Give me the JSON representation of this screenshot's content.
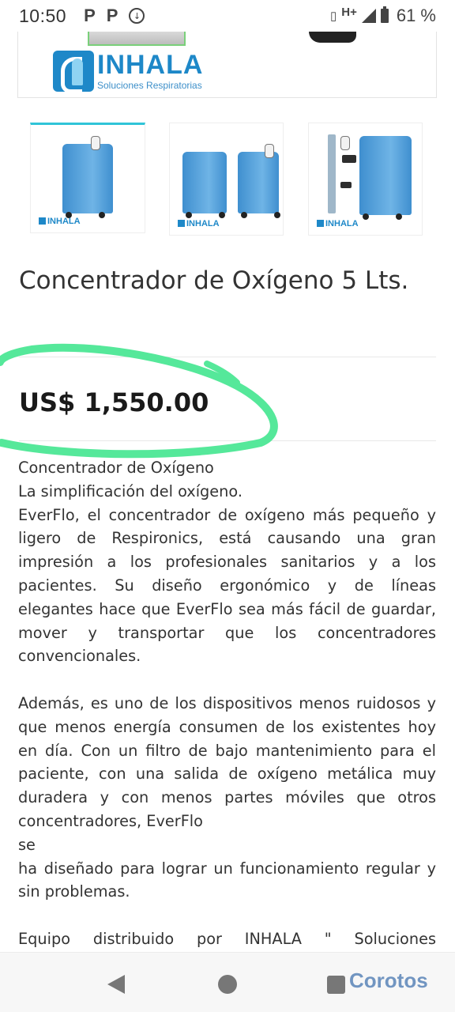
{
  "status_bar": {
    "time": "10:50",
    "left_icons": [
      "P",
      "P"
    ],
    "network": "H+",
    "battery": "61 %"
  },
  "logo": {
    "title": "INHALA",
    "subtitle": "Soluciones Respiratorias"
  },
  "thumbnails": [
    {
      "logo": "INHALA"
    },
    {
      "logo": "INHALA"
    },
    {
      "logo": "INHALA"
    }
  ],
  "product": {
    "title": "Concentrador de Oxígeno 5 Lts.",
    "price": "US$ 1,550.00",
    "description": {
      "line1": "Concentrador de Oxígeno",
      "line2": "La simplificación del oxígeno.",
      "para1": "EverFlo, el concentrador de oxígeno más pequeño y ligero de Respironics, está causando una gran impresión a los profesionales sanitarios y a los pacientes. Su diseño ergonómico y de líneas elegantes hace que EverFlo sea más fácil de guardar, mover y transportar que los concentradores convencionales.",
      "para2a": "Además, es uno de los dispositivos menos ruidosos y que menos energía consumen de los existentes hoy en día. Con un filtro de bajo mantenimiento para el paciente, con una salida de oxígeno metálica muy duradera y con menos partes móviles que otros concentradores, EverFlo",
      "para2b": "se",
      "para2c": "ha diseñado para lograr un funcionamiento regular y sin problemas.",
      "para3": "Equipo distribuido por INHALA \" Soluciones"
    }
  },
  "watermark": "Corotos",
  "colors": {
    "brand_blue": "#1e88c8",
    "highlight_green": "#55e89a"
  }
}
